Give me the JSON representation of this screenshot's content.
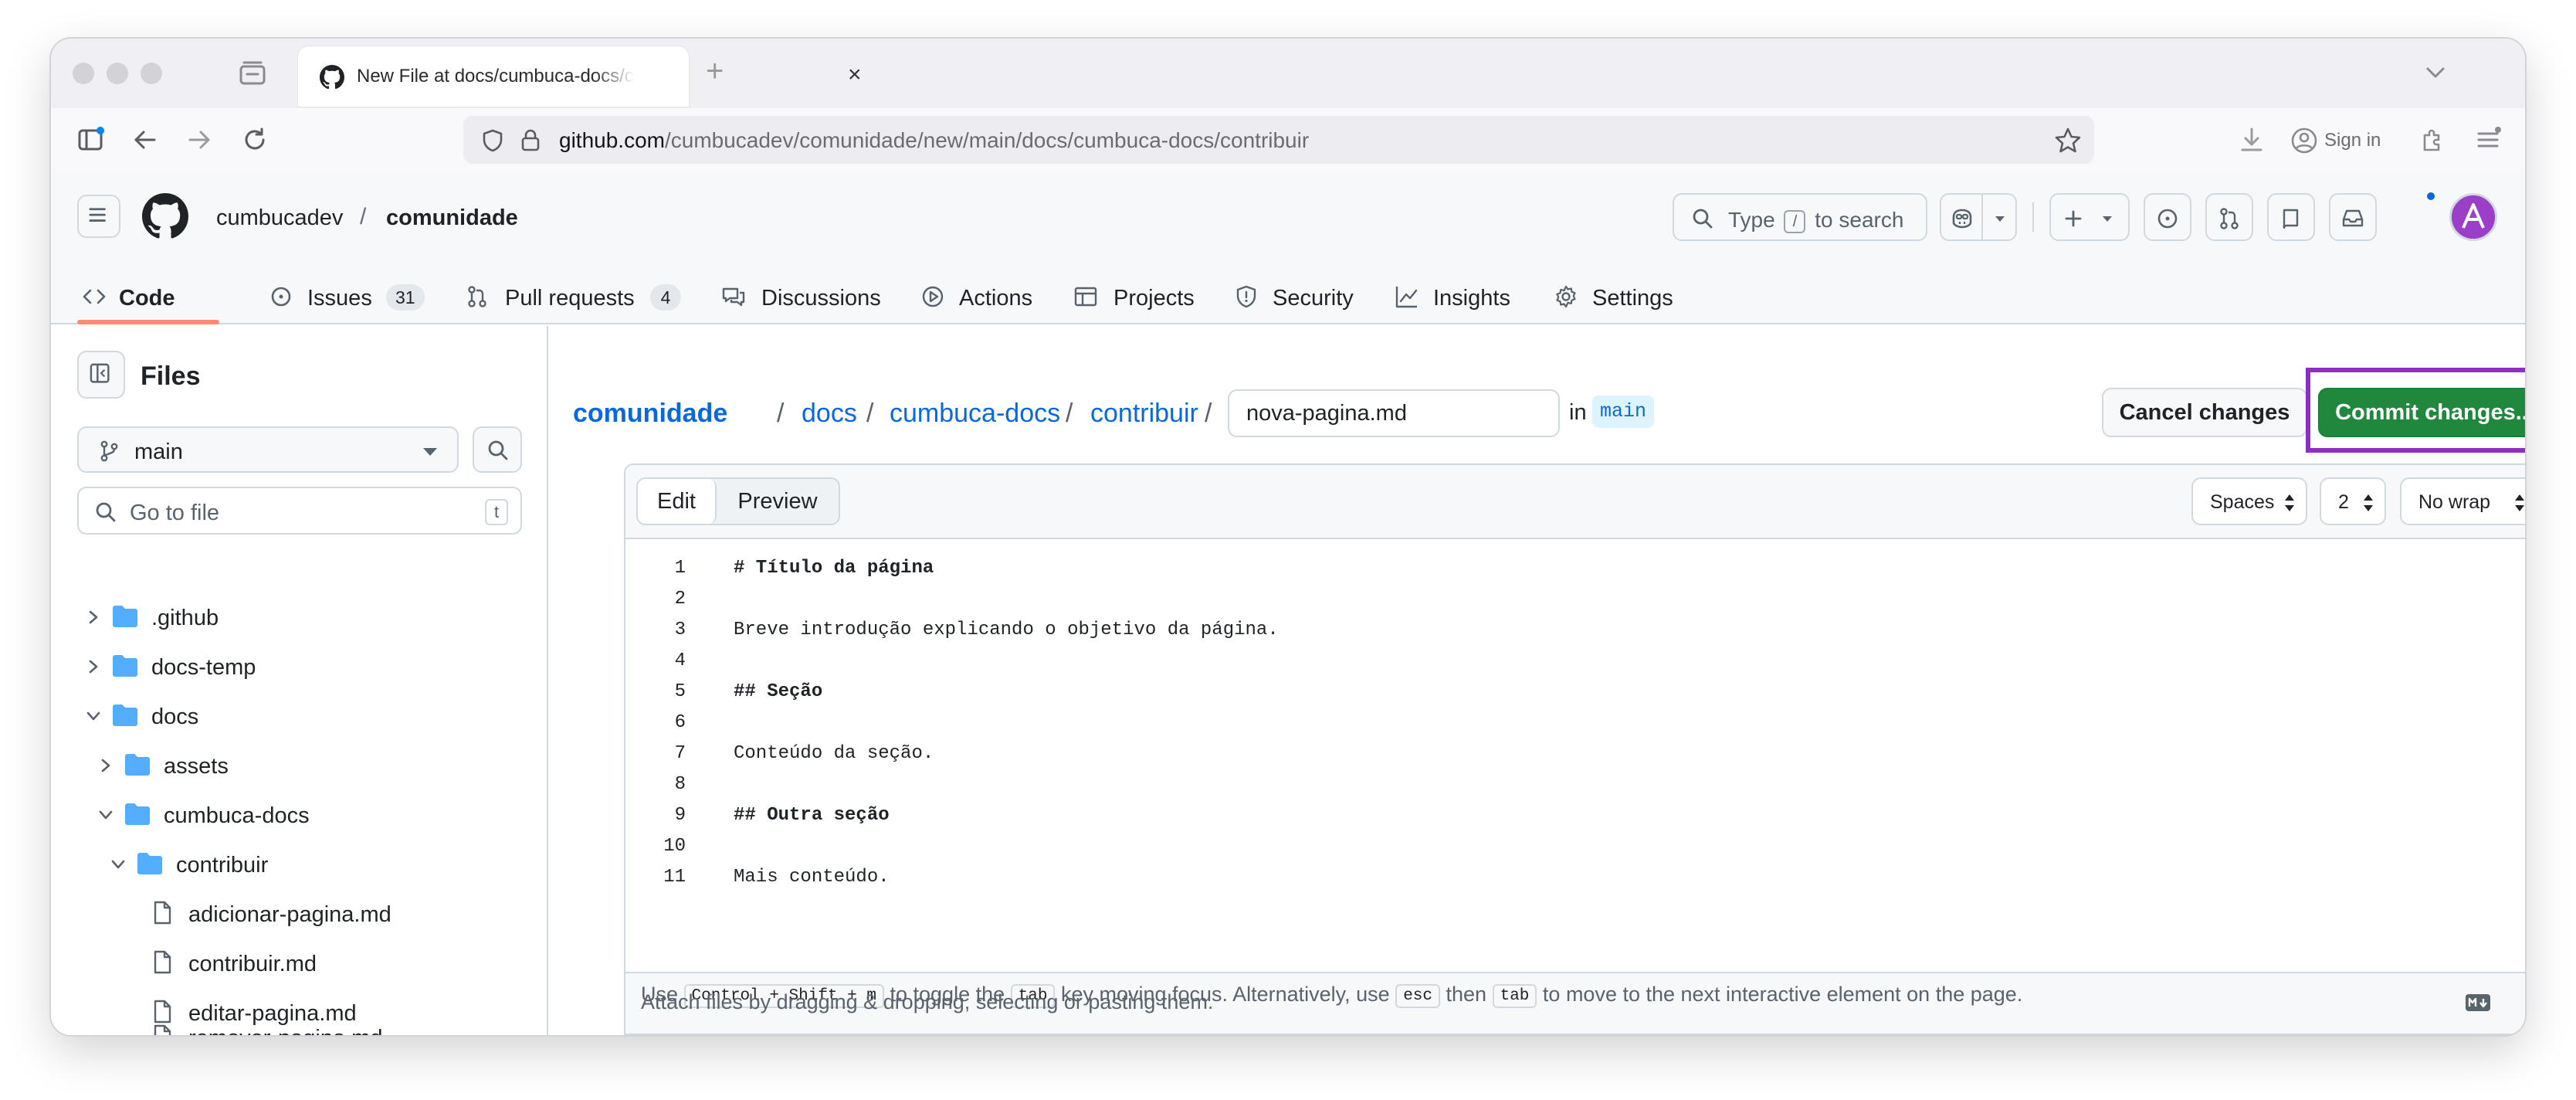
{
  "browser": {
    "tab_title": "New File at docs/cumbuca-docs/contribuir · cumbucadev/comunidade",
    "url_host": "github.com",
    "url_path": "/cumbucadev/comunidade/new/main/docs/cumbuca-docs/contribuir",
    "sign_in_label": "Sign in"
  },
  "header": {
    "owner": "cumbucadev",
    "separator": "/",
    "repo": "comunidade",
    "search_prefix": "Type",
    "search_key": "/",
    "search_suffix": "to search"
  },
  "repo_nav": {
    "items": [
      {
        "label": "Code",
        "icon": "code-icon"
      },
      {
        "label": "Issues",
        "count": "31",
        "icon": "issue-icon"
      },
      {
        "label": "Pull requests",
        "count": "4",
        "icon": "pull-request-icon"
      },
      {
        "label": "Discussions",
        "icon": "discussion-icon"
      },
      {
        "label": "Actions",
        "icon": "play-icon"
      },
      {
        "label": "Projects",
        "icon": "table-icon"
      },
      {
        "label": "Security",
        "icon": "shield-icon"
      },
      {
        "label": "Insights",
        "icon": "graph-icon"
      },
      {
        "label": "Settings",
        "icon": "gear-icon"
      }
    ]
  },
  "sidebar": {
    "title": "Files",
    "branch": "main",
    "goto_placeholder": "Go to file",
    "goto_key": "t",
    "tree": [
      {
        "name": ".github",
        "type": "folder",
        "expanded": false
      },
      {
        "name": "docs-temp",
        "type": "folder",
        "expanded": false
      },
      {
        "name": "docs",
        "type": "folder",
        "expanded": true
      },
      {
        "name": "assets",
        "type": "folder",
        "expanded": false
      },
      {
        "name": "cumbuca-docs",
        "type": "folder",
        "expanded": true
      },
      {
        "name": "contribuir",
        "type": "folder",
        "expanded": true
      },
      {
        "name": "adicionar-pagina.md",
        "type": "file"
      },
      {
        "name": "contribuir.md",
        "type": "file"
      },
      {
        "name": "editar-pagina.md",
        "type": "file"
      },
      {
        "name": "remover-pagina.md",
        "type": "file"
      }
    ]
  },
  "editor": {
    "breadcrumbs": [
      "comunidade",
      "docs",
      "cumbuca-docs",
      "contribuir"
    ],
    "separator": "/",
    "filename": "nova-pagina.md",
    "in_label": "in",
    "branch": "main",
    "cancel_label": "Cancel changes",
    "commit_label": "Commit changes...",
    "tab_edit": "Edit",
    "tab_preview": "Preview",
    "indent_mode": "Spaces",
    "indent_size": "2",
    "wrap_mode": "No wrap",
    "lines": [
      {
        "n": "1",
        "text": "# Título da página",
        "heading": true
      },
      {
        "n": "2",
        "text": "",
        "heading": false
      },
      {
        "n": "3",
        "text": "Breve introdução explicando o objetivo da página.",
        "heading": false
      },
      {
        "n": "4",
        "text": "",
        "heading": false
      },
      {
        "n": "5",
        "text": "## Seção",
        "heading": true
      },
      {
        "n": "6",
        "text": "",
        "heading": false
      },
      {
        "n": "7",
        "text": "Conteúdo da seção.",
        "heading": false
      },
      {
        "n": "8",
        "text": "",
        "heading": false
      },
      {
        "n": "9",
        "text": "## Outra seção",
        "heading": true
      },
      {
        "n": "10",
        "text": "",
        "heading": false
      },
      {
        "n": "11",
        "text": "Mais conteúdo.",
        "heading": false
      }
    ],
    "hint": {
      "use": "Use",
      "combo": "Control + Shift + m",
      "t1": "to toggle the",
      "tab": "tab",
      "t2": "key moving focus. Alternatively, use",
      "esc": "esc",
      "then": "then",
      "t3": "to move to the next interactive element on the page."
    },
    "attach_text": "Attach files by dragging & dropping, selecting or pasting them."
  },
  "colors": {
    "commit_green": "#1f883d",
    "highlight_purple": "#8a2ec4",
    "link_blue": "#0969da",
    "folder_blue": "#54aeff",
    "nav_underline": "#fd8c73"
  }
}
